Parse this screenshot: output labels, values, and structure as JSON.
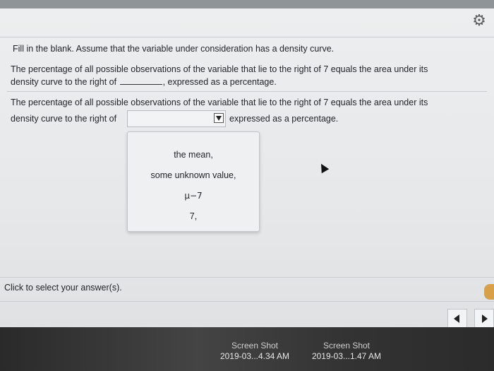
{
  "question": {
    "intro": "Fill in the blank. Assume that the variable under consideration has a density curve.",
    "line1": "The percentage of all possible observations of the variable that lie to the right of 7 equals the area under its",
    "line2_before": "density curve to the right of",
    "line2_after": ", expressed as a percentage."
  },
  "answer": {
    "line1": "The percentage of all possible observations of the variable that lie to the right of 7 equals the area under its",
    "line2_before": "density curve to the right of",
    "line2_after": "expressed as a percentage.",
    "select_value": ""
  },
  "dropdown": {
    "options": [
      "the mean,",
      "some unknown value,",
      "μ−7",
      "7,"
    ]
  },
  "footer": {
    "instruction": "Click to select your answer(s)."
  },
  "desktop": {
    "files": [
      {
        "title": "Screen Shot",
        "name": "2019-03...4.34 AM"
      },
      {
        "title": "Screen Shot",
        "name": "2019-03...1.47 AM"
      }
    ]
  },
  "icons": {
    "settings": "gear-icon",
    "prev": "left-arrow-icon",
    "next": "right-arrow-icon"
  }
}
